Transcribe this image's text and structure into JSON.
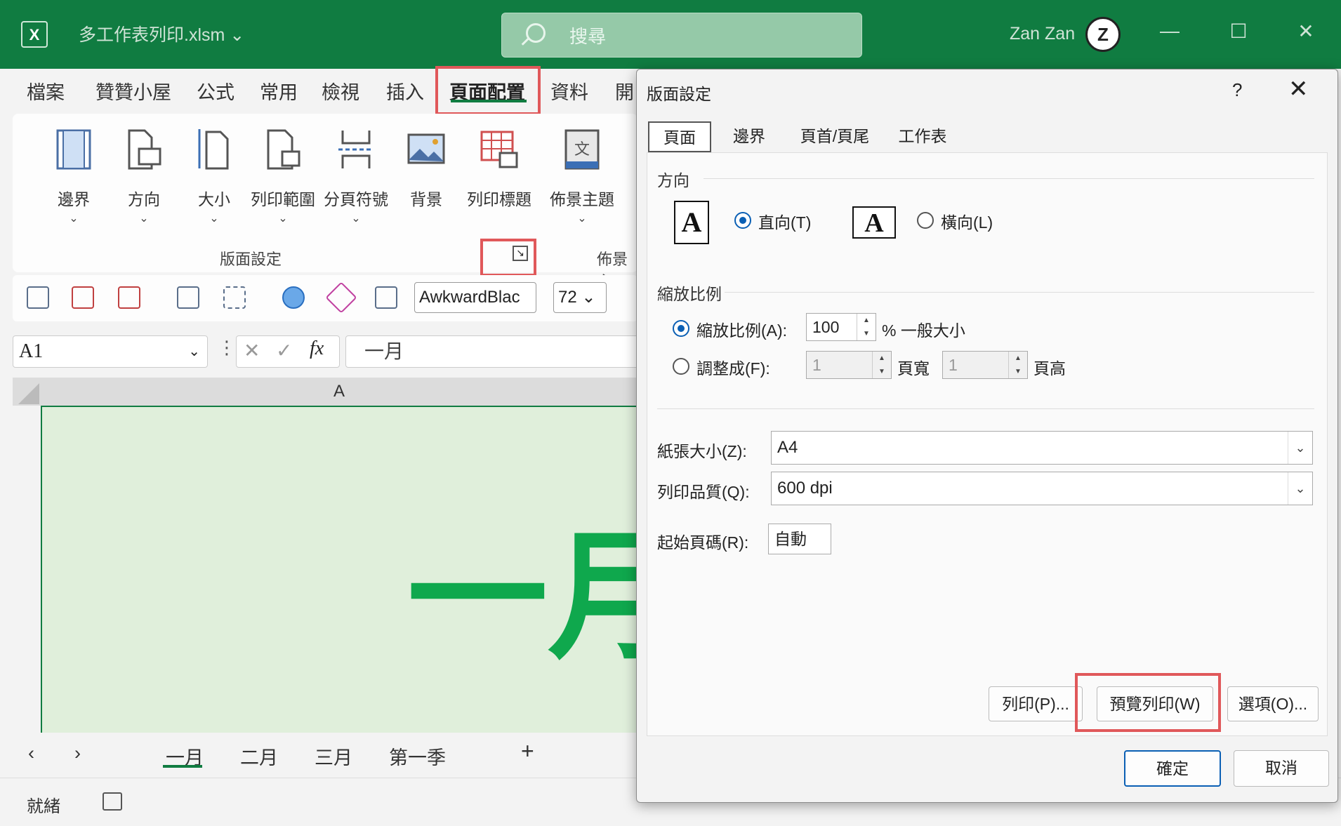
{
  "window": {
    "filename": "多工作表列印.xlsm",
    "search_placeholder": "搜尋",
    "username": "Zan Zan",
    "avatar_letter": "Z",
    "minimize": "—",
    "maximize": "☐",
    "close": "✕"
  },
  "menu_tabs": [
    "檔案",
    "贊贊小屋",
    "公式",
    "常用",
    "檢視",
    "插入",
    "頁面配置",
    "資料",
    "開"
  ],
  "ribbon": {
    "buttons": [
      "邊界",
      "方向",
      "大小",
      "列印範圍",
      "分頁符號",
      "背景",
      "列印標題",
      "佈景主題"
    ],
    "group_label": "版面設定",
    "group_label2": "佈景主"
  },
  "toolbar": {
    "font": "AwkwardBlac",
    "size": "72"
  },
  "formula_bar": {
    "namebox": "A1",
    "fx": "fx",
    "value": "一月"
  },
  "grid": {
    "column": "A",
    "cell_value": "一月"
  },
  "sheets": [
    "一月",
    "二月",
    "三月",
    "第一季"
  ],
  "sheet_add": "+",
  "status": {
    "text": "就緒"
  },
  "dialog": {
    "title": "版面設定",
    "help": "?",
    "close": "✕",
    "tabs": [
      "頁面",
      "邊界",
      "頁首/頁尾",
      "工作表"
    ],
    "orientation": {
      "section": "方向",
      "portrait": "直向(T)",
      "landscape": "橫向(L)",
      "icon_letter": "A"
    },
    "scaling": {
      "section": "縮放比例",
      "adjust_label": "縮放比例(A):",
      "adjust_value": "100",
      "adjust_suffix": "% 一般大小",
      "fit_label": "調整成(F):",
      "fit_wide": "1",
      "fit_wide_suffix": "頁寬",
      "fit_tall": "1",
      "fit_tall_suffix": "頁高"
    },
    "paper_size_label": "紙張大小(Z):",
    "paper_size": "A4",
    "print_quality_label": "列印品質(Q):",
    "print_quality": "600 dpi",
    "first_page_label": "起始頁碼(R):",
    "first_page": "自動",
    "buttons": {
      "print": "列印(P)...",
      "preview": "預覽列印(W)",
      "options": "選項(O)...",
      "ok": "確定",
      "cancel": "取消"
    }
  },
  "colors": {
    "accent": "#107c41",
    "highlight": "#e0585a",
    "cell_text": "#0fa84d"
  }
}
